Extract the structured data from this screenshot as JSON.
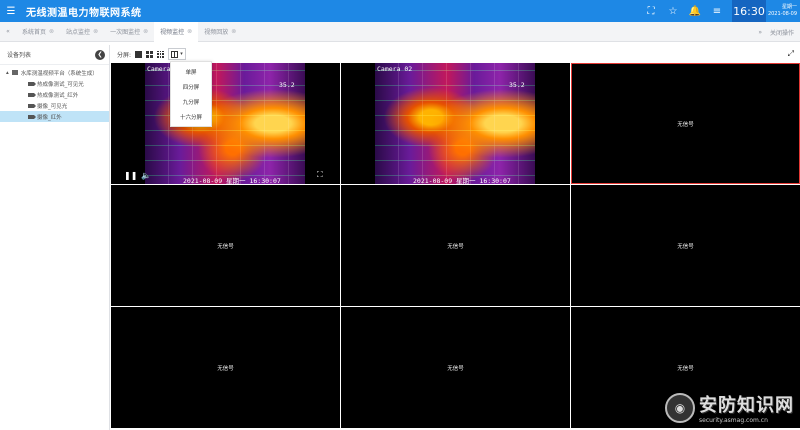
{
  "topbar": {
    "title": "无线测温电力物联网系统",
    "time": "16:30",
    "weekday": "星期一",
    "date": "2021-08-09",
    "icons": [
      "menu-icon",
      "fullscreen-icon",
      "star-icon",
      "bell-icon",
      "list-icon"
    ],
    "accent": "#1e88e5"
  },
  "tabs": {
    "items": [
      {
        "label": "系统首页"
      },
      {
        "label": "站点监控"
      },
      {
        "label": "一次图监控"
      },
      {
        "label": "视频监控"
      },
      {
        "label": "视频回放"
      }
    ],
    "active_index": 3,
    "close_ops": "关闭操作"
  },
  "sidebar": {
    "header": "设备列表",
    "root": "水库测温视频平台（系统生成）",
    "items": [
      {
        "label": "热成像测试_可见光"
      },
      {
        "label": "热成像测试_红外"
      },
      {
        "label": "摄像_可见光"
      },
      {
        "label": "摄像_红外"
      }
    ],
    "selected_index": 3
  },
  "toolbar": {
    "split_label": "分屏:"
  },
  "split_menu": {
    "options": [
      "单屏",
      "四分屏",
      "九分屏",
      "十六分屏"
    ]
  },
  "video": {
    "no_signal": "无信号",
    "cam1": {
      "name": "Camera 01",
      "temp": "35.2",
      "timestamp": "2021-08-09 星期一 16:30:07"
    },
    "cam2": {
      "name": "Camera 02",
      "temp": "35.2",
      "timestamp": "2021-08-09 星期一 16:30:07"
    }
  },
  "watermark": {
    "title": "安防知识网",
    "url": "security.asmag.com.cn"
  }
}
